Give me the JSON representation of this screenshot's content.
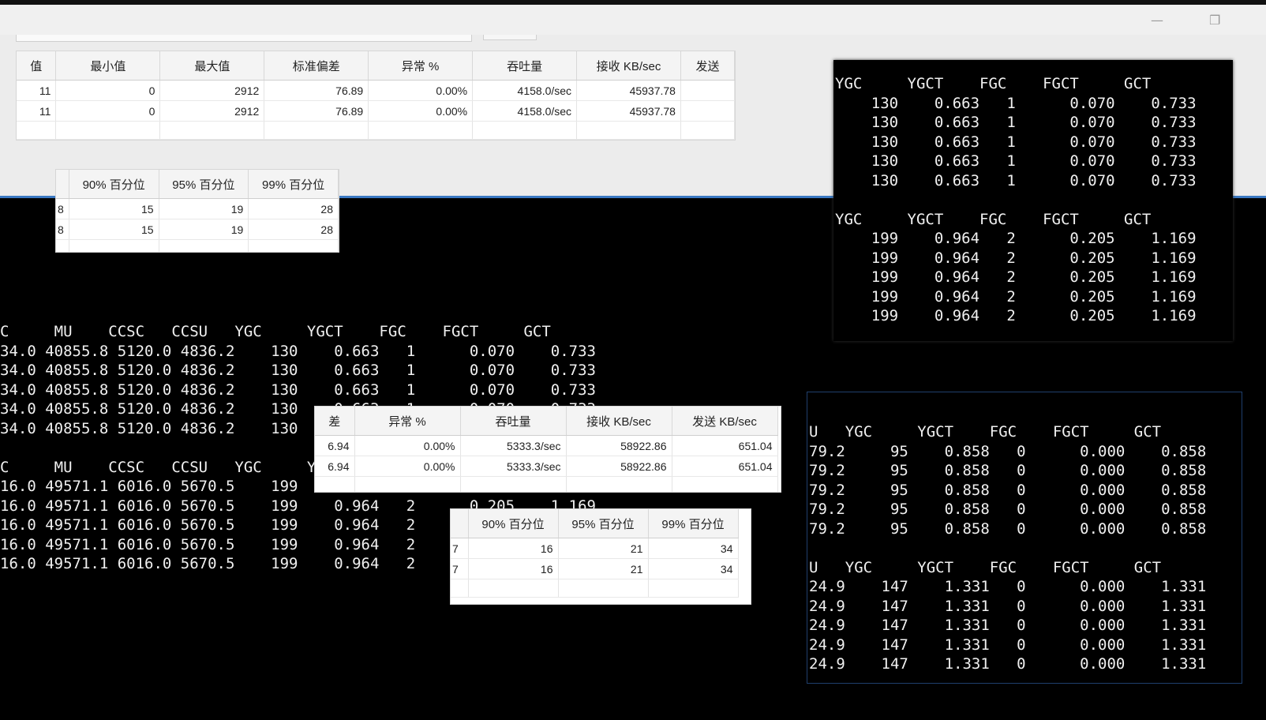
{
  "window": {
    "minimize": "—",
    "restore": "❐"
  },
  "table_top": {
    "headers": [
      "值",
      "最小值",
      "最大值",
      "标准偏差",
      "异常 %",
      "吞吐量",
      "接收 KB/sec",
      "发送"
    ],
    "rows": [
      [
        "11",
        "0",
        "2912",
        "76.89",
        "0.00%",
        "4158.0/sec",
        "45937.78",
        ""
      ],
      [
        "11",
        "0",
        "2912",
        "76.89",
        "0.00%",
        "4158.0/sec",
        "45937.78",
        ""
      ]
    ]
  },
  "percentile_top": {
    "headers": [
      "",
      "90% 百分位",
      "95% 百分位",
      "99% 百分位"
    ],
    "rows": [
      [
        "8",
        "15",
        "19",
        "28"
      ],
      [
        "8",
        "15",
        "19",
        "28"
      ]
    ]
  },
  "table_mid": {
    "headers": [
      "差",
      "异常 %",
      "吞吐量",
      "接收 KB/sec",
      "发送 KB/sec"
    ],
    "rows": [
      [
        "6.94",
        "0.00%",
        "5333.3/sec",
        "58922.86",
        "651.04"
      ],
      [
        "6.94",
        "0.00%",
        "5333.3/sec",
        "58922.86",
        "651.04"
      ]
    ]
  },
  "percentile_mid": {
    "headers": [
      "",
      "90% 百分位",
      "95% 百分位",
      "99% 百分位"
    ],
    "rows": [
      [
        "7",
        "16",
        "21",
        "34"
      ],
      [
        "7",
        "16",
        "21",
        "34"
      ]
    ]
  },
  "term_left": {
    "text": "C     MU    CCSC   CCSU   YGC     YGCT    FGC    FGCT     GCT\n34.0 40855.8 5120.0 4836.2    130    0.663   1      0.070    0.733\n34.0 40855.8 5120.0 4836.2    130    0.663   1      0.070    0.733\n34.0 40855.8 5120.0 4836.2    130    0.663   1      0.070    0.733\n34.0 40855.8 5120.0 4836.2    130    0.663   1      0.070    0.733\n34.0 40855.8 5120.0 4836.2    130    0.663   1      0.070    0.733\n\nC     MU    CCSC   CCSU   YGC     YGCT    FGC    FGCT     GCT\n16.0 49571.1 6016.0 5670.5    199    0.964   2      0.205    1.169\n16.0 49571.1 6016.0 5670.5    199    0.964   2      0.205    1.169\n16.0 49571.1 6016.0 5670.5    199    0.964   2      0.205    1.169\n16.0 49571.1 6016.0 5670.5    199    0.964   2      0.205    1.169\n16.0 49571.1 6016.0 5670.5    199    0.964   2      0.205    1.169"
  },
  "term_right_top": {
    "text": "YGC     YGCT    FGC    FGCT     GCT\n    130    0.663   1      0.070    0.733\n    130    0.663   1      0.070    0.733\n    130    0.663   1      0.070    0.733\n    130    0.663   1      0.070    0.733\n    130    0.663   1      0.070    0.733\n\nYGC     YGCT    FGC    FGCT     GCT\n    199    0.964   2      0.205    1.169\n    199    0.964   2      0.205    1.169\n    199    0.964   2      0.205    1.169\n    199    0.964   2      0.205    1.169\n    199    0.964   2      0.205    1.169"
  },
  "term_right_bottom": {
    "text": "U   YGC     YGCT    FGC    FGCT     GCT\n79.2     95    0.858   0      0.000    0.858\n79.2     95    0.858   0      0.000    0.858\n79.2     95    0.858   0      0.000    0.858\n79.2     95    0.858   0      0.000    0.858\n79.2     95    0.858   0      0.000    0.858\n\nU   YGC     YGCT    FGC    FGCT     GCT\n24.9    147    1.331   0      0.000    1.331\n24.9    147    1.331   0      0.000    1.331\n24.9    147    1.331   0      0.000    1.331\n24.9    147    1.331   0      0.000    1.331\n24.9    147    1.331   0      0.000    1.331"
  }
}
